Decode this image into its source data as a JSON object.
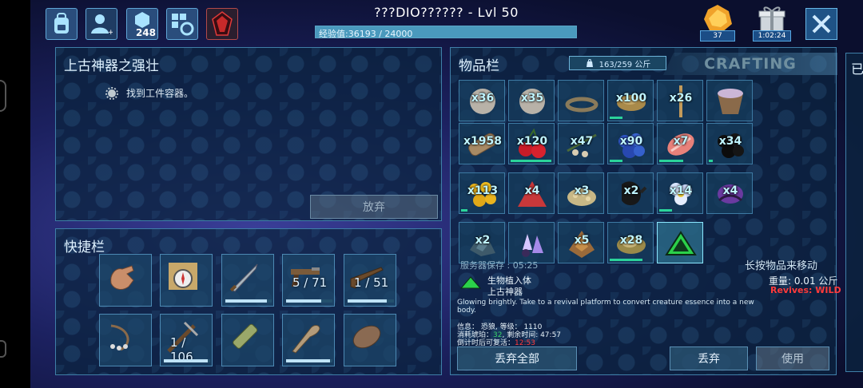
{
  "header": {
    "player_name": "???DIO?????? - Lvl 50",
    "xp_text": "经验值:36193 / 24000",
    "xp_progress": 1.0,
    "engram_points": "248",
    "amber_count": "37",
    "gift_timer": "1:02:24"
  },
  "quest": {
    "title": "上古神器之强壮",
    "objective": "找到工件容器。",
    "abandon_label": "放弃"
  },
  "hotbar": {
    "title": "快捷栏",
    "slots": [
      {
        "icon": "hand-icon",
        "qty": "",
        "durability": null
      },
      {
        "icon": "map-compass-icon",
        "qty": "",
        "durability": null
      },
      {
        "icon": "sword-icon",
        "qty": "",
        "durability": 0.9
      },
      {
        "icon": "pistol-icon",
        "qty": "5 / 71",
        "durability": 0.75
      },
      {
        "icon": "rifle-icon",
        "qty": "1 / 51",
        "durability": 0.85
      },
      {
        "icon": "whip-icon",
        "qty": "",
        "durability": null
      },
      {
        "icon": "crossbow-icon",
        "qty": "1 / 106",
        "durability": 0.95
      },
      {
        "icon": "spyglass-icon",
        "qty": "",
        "durability": null
      },
      {
        "icon": "club-icon",
        "qty": "",
        "durability": 0.95
      },
      {
        "icon": "sleeping-bag-icon",
        "qty": "",
        "durability": null
      }
    ]
  },
  "inventory": {
    "title": "物品栏",
    "weight": "163/259 公斤",
    "crafting_tab": "CRAFTING",
    "items": [
      {
        "icon": "stone-icon",
        "qty": "x36",
        "bar": null
      },
      {
        "icon": "stone-icon",
        "qty": "x35",
        "bar": null
      },
      {
        "icon": "thatch-icon",
        "qty": "",
        "bar": null
      },
      {
        "icon": "metal-ingot-icon",
        "qty": "x100",
        "bar": 0.3
      },
      {
        "icon": "stick-icon",
        "qty": "x26",
        "bar": null
      },
      {
        "icon": "mortar-icon",
        "qty": "",
        "bar": null
      },
      {
        "icon": "wood-icon",
        "qty": "x1958",
        "bar": null
      },
      {
        "icon": "cherry-icon",
        "qty": "x120",
        "bar": 0.95
      },
      {
        "icon": "fiber-seeds-icon",
        "qty": "x47",
        "bar": null
      },
      {
        "icon": "berry-blue-icon",
        "qty": "x90",
        "bar": 0.3
      },
      {
        "icon": "meat-icon",
        "qty": "x7",
        "bar": 0.55
      },
      {
        "icon": "berry-black-icon",
        "qty": "x34",
        "bar": 0.1
      },
      {
        "icon": "berry-yellow-icon",
        "qty": "x113",
        "bar": 0.15
      },
      {
        "icon": "pile-red-icon",
        "qty": "x4",
        "bar": null
      },
      {
        "icon": "seeds-icon",
        "qty": "x3",
        "bar": null
      },
      {
        "icon": "sack-icon",
        "qty": "x2",
        "bar": null
      },
      {
        "icon": "flower-icon",
        "qty": "x14",
        "bar": 0.3
      },
      {
        "icon": "purple-plant-icon",
        "qty": "x4",
        "bar": null
      },
      {
        "icon": "flint-icon",
        "qty": "x2",
        "bar": null
      },
      {
        "icon": "crystal-icon",
        "qty": "",
        "bar": null
      },
      {
        "icon": "metal-ore-icon",
        "qty": "x5",
        "bar": null
      },
      {
        "icon": "obsidian-icon",
        "qty": "x28",
        "bar": 0.75
      },
      {
        "icon": "implant-icon",
        "qty": "",
        "bar": null,
        "selected": true
      }
    ],
    "server_protect": "服务器保存 : 05:25",
    "move_hint": "长按物品来移动"
  },
  "detail": {
    "name_line1": "生物植入体",
    "name_line2": "上古神器",
    "weight": "重量: 0.01 公斤",
    "revives": "Revives: WILD",
    "description": "Glowing brightly. Take to a revival platform to convert creature essence into a new body.",
    "info_line1": "信息：  恐狼, 等级： 1110",
    "info_line2_prefix": "消耗琥珀：",
    "info_line2_value": "32",
    "info_line2_suffix": ", 剩余时间: 47:57",
    "info_line3_prefix": "倒计时后可复活：",
    "info_line3_value": "12:53",
    "drop_all": "丢弃全部",
    "drop": "丢弃",
    "use": "使用"
  },
  "colors": {
    "accent": "#4a99bd",
    "green_value": "#39d36a",
    "red_value": "#ff3b3b",
    "panel_border": "#3f7fa8"
  }
}
